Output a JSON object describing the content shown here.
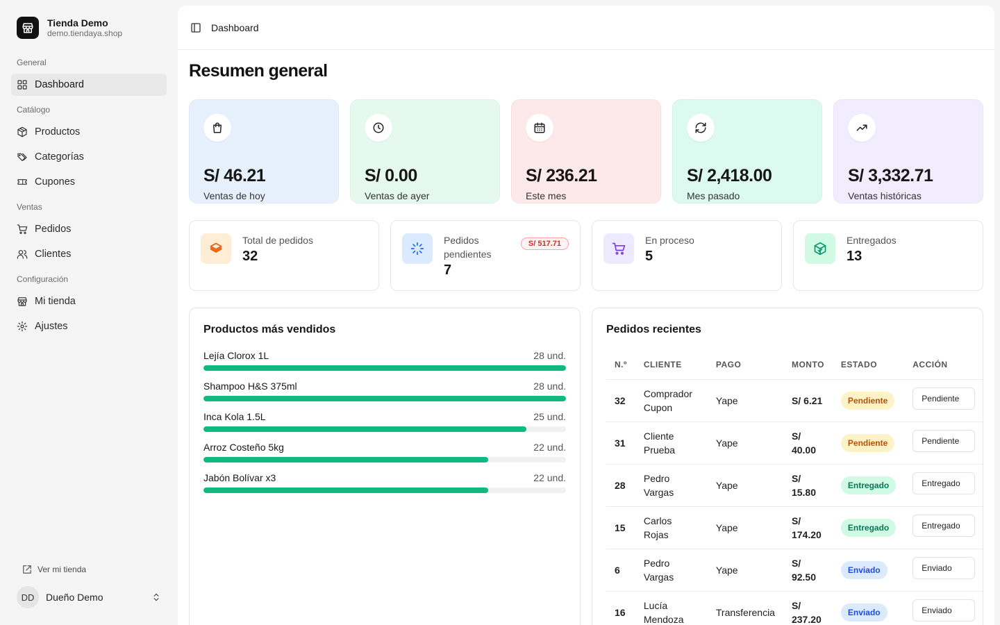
{
  "store": {
    "name": "Tienda Demo",
    "domain": "demo.tiendaya.shop"
  },
  "sidebar": {
    "groups": [
      {
        "label": "General",
        "items": [
          {
            "label": "Dashboard",
            "icon": "grid-icon",
            "active": true
          }
        ]
      },
      {
        "label": "Catálogo",
        "items": [
          {
            "label": "Productos",
            "icon": "package-icon"
          },
          {
            "label": "Categorías",
            "icon": "tags-icon"
          },
          {
            "label": "Cupones",
            "icon": "ticket-icon"
          }
        ]
      },
      {
        "label": "Ventas",
        "items": [
          {
            "label": "Pedidos",
            "icon": "cart-icon"
          },
          {
            "label": "Clientes",
            "icon": "users-icon"
          }
        ]
      },
      {
        "label": "Configuración",
        "items": [
          {
            "label": "Mi tienda",
            "icon": "store-icon"
          },
          {
            "label": "Ajustes",
            "icon": "gear-icon"
          }
        ]
      }
    ],
    "view_store": "Ver mi tienda",
    "user": {
      "initials": "DD",
      "name": "Dueño Demo"
    }
  },
  "topbar": {
    "title": "Dashboard"
  },
  "page_title": "Resumen general",
  "stats": [
    {
      "value": "S/ 46.21",
      "label": "Ventas de hoy",
      "icon": "bag-icon",
      "bg": "#e7f1fe"
    },
    {
      "value": "S/ 0.00",
      "label": "Ventas de ayer",
      "icon": "clock-icon",
      "bg": "#e5f9ef"
    },
    {
      "value": "S/ 236.21",
      "label": "Este mes",
      "icon": "calendar-icon",
      "bg": "#fde8ea"
    },
    {
      "value": "S/ 2,418.00",
      "label": "Mes pasado",
      "icon": "refresh-icon",
      "bg": "#dcfaf0"
    },
    {
      "value": "S/ 3,332.71",
      "label": "Ventas históricas",
      "icon": "trending-up-icon",
      "bg": "#f1edfe"
    }
  ],
  "order_cards": [
    {
      "label": "Total de pedidos",
      "value": "32",
      "icon": "layers-icon",
      "icon_bg": "#ffedd5",
      "icon_color": "#ea580c"
    },
    {
      "label": "Pedidos pendientes",
      "value": "7",
      "icon": "loader-icon",
      "icon_bg": "#dbeafe",
      "icon_color": "#2563eb",
      "badge": "S/ 517.71"
    },
    {
      "label": "En proceso",
      "value": "5",
      "icon": "cart-icon",
      "icon_bg": "#ede9fe",
      "icon_color": "#7c3aed"
    },
    {
      "label": "Entregados",
      "value": "13",
      "icon": "package-check-icon",
      "icon_bg": "#d1fae5",
      "icon_color": "#059669"
    }
  ],
  "top_products": {
    "title": "Productos más vendidos",
    "items": [
      {
        "name": "Lejía Clorox 1L",
        "qty_label": "28 und.",
        "qty": 28
      },
      {
        "name": "Shampoo H&S 375ml",
        "qty_label": "28 und.",
        "qty": 28
      },
      {
        "name": "Inca Kola 1.5L",
        "qty_label": "25 und.",
        "qty": 25
      },
      {
        "name": "Arroz Costeño 5kg",
        "qty_label": "22 und.",
        "qty": 22
      },
      {
        "name": "Jabón Bolívar x3",
        "qty_label": "22 und.",
        "qty": 22
      }
    ],
    "max": 28
  },
  "recent_orders": {
    "title": "Pedidos recientes",
    "columns": [
      "N.º",
      "CLIENTE",
      "PAGO",
      "MONTO",
      "ESTADO",
      "ACCIÓN"
    ],
    "rows": [
      {
        "num": "32",
        "client": "Comprador Cupon",
        "payment": "Yape",
        "amount": "S/ 6.21",
        "status": "Pendiente",
        "status_type": "pending",
        "action": "Pendiente"
      },
      {
        "num": "31",
        "client": "Cliente Prueba",
        "payment": "Yape",
        "amount": "S/ 40.00",
        "status": "Pendiente",
        "status_type": "pending",
        "action": "Pendiente"
      },
      {
        "num": "28",
        "client": "Pedro Vargas",
        "payment": "Yape",
        "amount": "S/ 15.80",
        "status": "Entregado",
        "status_type": "delivered",
        "action": "Entregado"
      },
      {
        "num": "15",
        "client": "Carlos Rojas",
        "payment": "Yape",
        "amount": "S/ 174.20",
        "status": "Entregado",
        "status_type": "delivered",
        "action": "Entregado"
      },
      {
        "num": "6",
        "client": "Pedro Vargas",
        "payment": "Yape",
        "amount": "S/ 92.50",
        "status": "Enviado",
        "status_type": "sent",
        "action": "Enviado"
      },
      {
        "num": "16",
        "client": "Lucía Mendoza",
        "payment": "Transferencia",
        "amount": "S/ 237.20",
        "status": "Enviado",
        "status_type": "sent",
        "action": "Enviado"
      }
    ]
  }
}
